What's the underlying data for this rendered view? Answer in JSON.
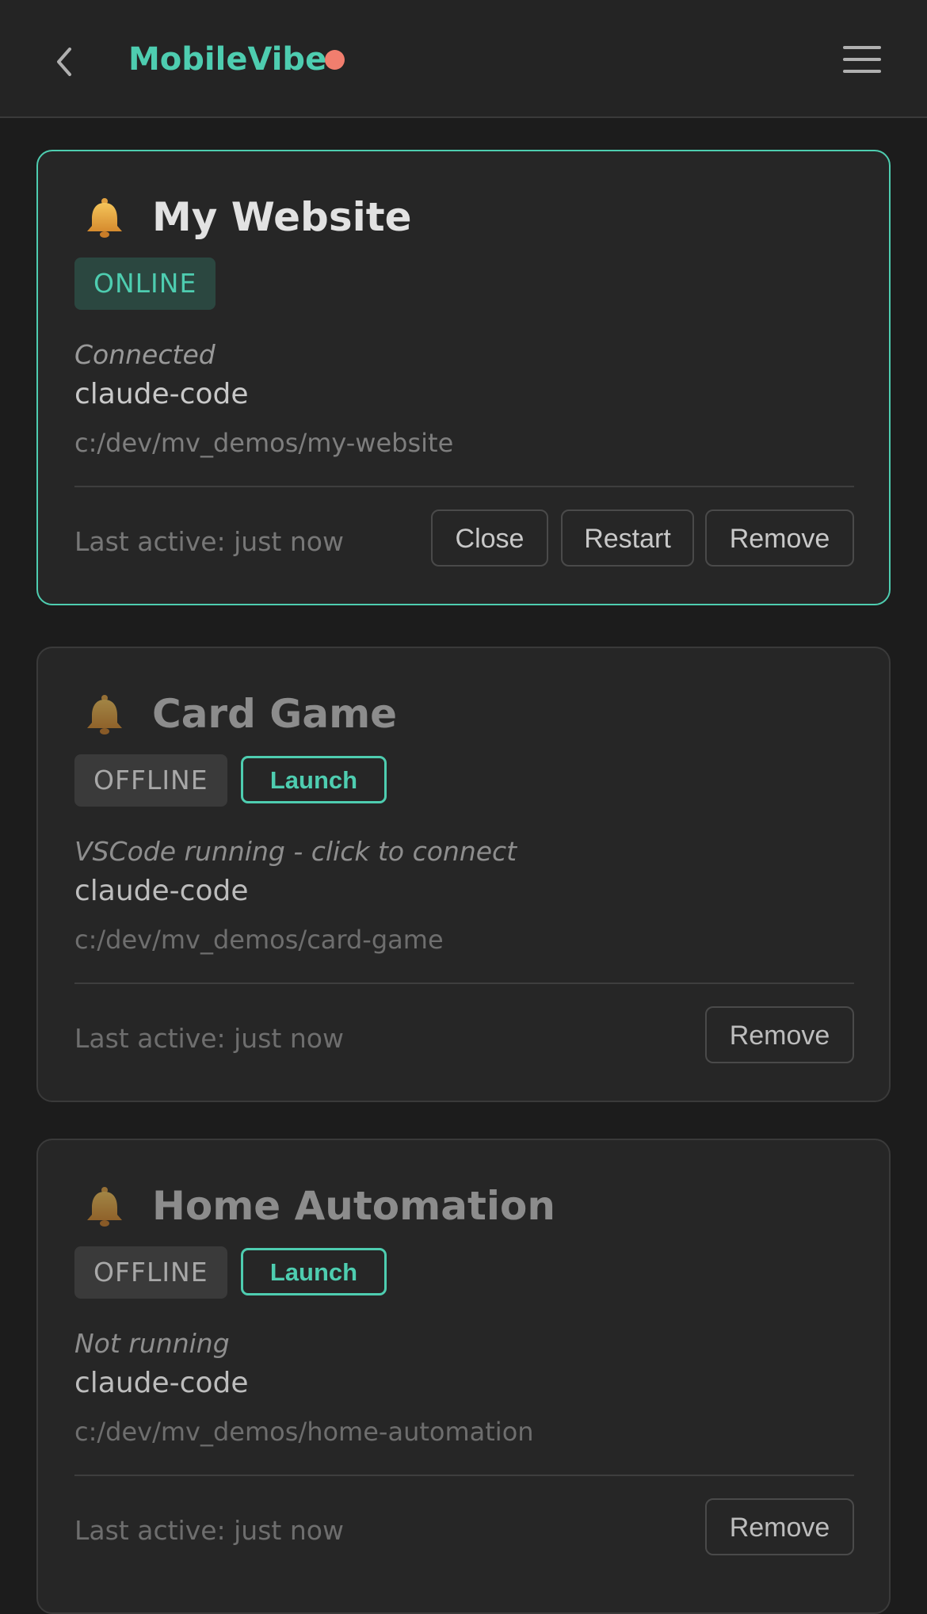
{
  "header": {
    "app_title": "MobileVibe",
    "status_dot_color": "#f17e6e",
    "accent_color": "#4ecdb0"
  },
  "projects": [
    {
      "name": "My Website",
      "status": "ONLINE",
      "status_text": "Connected",
      "agent": "claude-code",
      "path": "c:/dev/mv_demos/my-website",
      "last_active": "Last active: just now",
      "buttons": {
        "close": "Close",
        "restart": "Restart",
        "remove": "Remove"
      }
    },
    {
      "name": "Card Game",
      "status": "OFFLINE",
      "launch_label": "Launch",
      "status_text": "VSCode running - click to connect",
      "agent": "claude-code",
      "path": "c:/dev/mv_demos/card-game",
      "last_active": "Last active: just now",
      "buttons": {
        "remove": "Remove"
      }
    },
    {
      "name": "Home Automation",
      "status": "OFFLINE",
      "launch_label": "Launch",
      "status_text": "Not running",
      "agent": "claude-code",
      "path": "c:/dev/mv_demos/home-automation",
      "last_active": "Last active: just now",
      "buttons": {
        "remove": "Remove"
      }
    }
  ]
}
